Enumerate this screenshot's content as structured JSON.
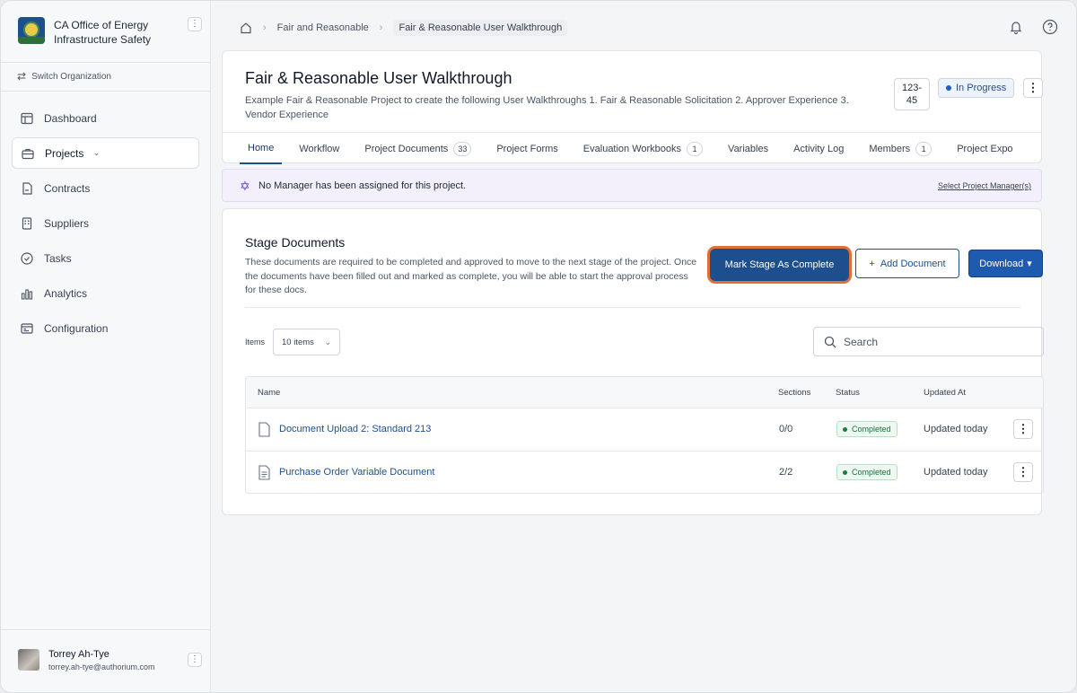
{
  "sidebar": {
    "org_name": "CA Office of Energy Infrastructure Safety",
    "switch_org_label": "Switch Organization",
    "items": [
      {
        "label": "Dashboard",
        "icon": "dashboard-icon"
      },
      {
        "label": "Projects",
        "icon": "briefcase-icon",
        "active": true
      },
      {
        "label": "Contracts",
        "icon": "contract-icon"
      },
      {
        "label": "Suppliers",
        "icon": "building-icon"
      },
      {
        "label": "Tasks",
        "icon": "check-circle-icon"
      },
      {
        "label": "Analytics",
        "icon": "bar-chart-icon"
      },
      {
        "label": "Configuration",
        "icon": "settings-panel-icon"
      }
    ],
    "user": {
      "name": "Torrey Ah-Tye",
      "email": "torrey.ah-tye@authorium.com"
    }
  },
  "breadcrumb": {
    "items": [
      "Fair and Reasonable",
      "Fair & Reasonable User Walkthrough"
    ]
  },
  "project": {
    "title": "Fair & Reasonable User Walkthrough",
    "description": "Example Fair & Reasonable Project to create the following User Walkthroughs 1. Fair & Reasonable Solicitation 2. Approver Experience 3. Vendor Experience",
    "id_line1": "123-",
    "id_line2": "45",
    "status": "In Progress",
    "status_color": "#1d5fc8"
  },
  "tabs": [
    {
      "label": "Home",
      "count": null
    },
    {
      "label": "Workflow",
      "count": null
    },
    {
      "label": "Project Documents",
      "count": "33"
    },
    {
      "label": "Project Forms",
      "count": null
    },
    {
      "label": "Evaluation Workbooks",
      "count": "1"
    },
    {
      "label": "Variables",
      "count": null
    },
    {
      "label": "Activity Log",
      "count": null
    },
    {
      "label": "Members",
      "count": "1"
    },
    {
      "label": "Project Expo",
      "count": null
    }
  ],
  "banner": {
    "text": "No Manager has been assigned for this project.",
    "link": "Select Project Manager(s)"
  },
  "stage": {
    "title": "Stage Documents",
    "description": "These documents are required to be completed and approved to move to the next stage of the project. Once the documents have been filled out and marked as complete, you will be able to start the approval process for these docs.",
    "mark_complete_label": "Mark Stage As Complete",
    "add_document_label": "Add Document",
    "download_label": "Download",
    "items_label": "Items",
    "items_value": "10 items",
    "search_placeholder": "Search",
    "columns": {
      "name": "Name",
      "sections": "Sections",
      "status": "Status",
      "updated": "Updated At"
    },
    "rows": [
      {
        "name": "Document Upload 2: Standard 213",
        "sections": "0/0",
        "status": "Completed",
        "updated": "Updated today"
      },
      {
        "name": "Purchase Order Variable Document",
        "sections": "2/2",
        "status": "Completed",
        "updated": "Updated today"
      }
    ]
  },
  "colors": {
    "accent": "#1d4f8f",
    "focus_ring": "#e0703a",
    "completed_green": "#1f7a43",
    "banner_bg": "#f3f0fc"
  }
}
